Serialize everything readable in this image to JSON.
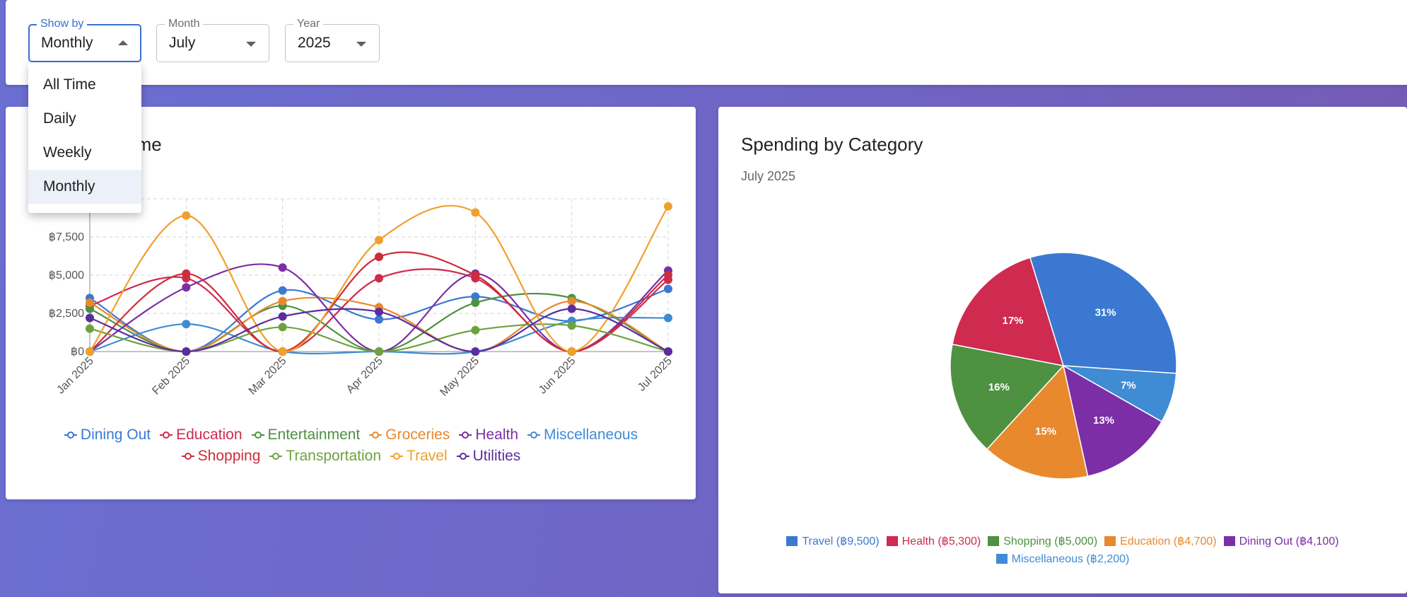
{
  "filters": {
    "show_by": {
      "label": "Show by",
      "value": "Monthly"
    },
    "month": {
      "label": "Month",
      "value": "July"
    },
    "year": {
      "label": "Year",
      "value": "2025"
    }
  },
  "dropdown": {
    "options": [
      "All Time",
      "Daily",
      "Weekly",
      "Monthly"
    ],
    "selected": "Monthly"
  },
  "line_card": {
    "title": "Spending Over Time",
    "visible_title_fragment": "er Time"
  },
  "pie_card": {
    "title": "Spending by Category",
    "subtitle": "July 2025"
  },
  "chart_data": [
    {
      "type": "line",
      "title": "Spending Over Time",
      "x": [
        "Jan 2025",
        "Feb 2025",
        "Mar 2025",
        "Apr 2025",
        "May 2025",
        "Jun 2025",
        "Jul 2025"
      ],
      "y_ticks": [
        "฿0",
        "฿2,500",
        "฿5,000",
        "฿7,500"
      ],
      "ylim": [
        0,
        10000
      ],
      "grid": true,
      "legend_position": "bottom",
      "series": [
        {
          "name": "Dining Out",
          "color": "#3a78d2",
          "values": [
            3500,
            0,
            4000,
            2100,
            3600,
            2000,
            4100
          ]
        },
        {
          "name": "Education",
          "color": "#cf2a4f",
          "values": [
            3000,
            4800,
            0,
            4800,
            4800,
            0,
            4700
          ]
        },
        {
          "name": "Entertainment",
          "color": "#4d9141",
          "values": [
            2800,
            0,
            3000,
            0,
            3200,
            3500,
            0
          ]
        },
        {
          "name": "Groceries",
          "color": "#e8892e",
          "values": [
            3200,
            0,
            3300,
            2900,
            0,
            3300,
            0
          ]
        },
        {
          "name": "Health",
          "color": "#7b2ea6",
          "values": [
            0,
            4200,
            5500,
            0,
            5100,
            0,
            5300
          ]
        },
        {
          "name": "Miscellaneous",
          "color": "#3f8bd4",
          "values": [
            0,
            1800,
            0,
            0,
            0,
            2000,
            2200
          ]
        },
        {
          "name": "Shopping",
          "color": "#cc2d3a",
          "values": [
            0,
            5100,
            0,
            6200,
            5000,
            0,
            5000
          ]
        },
        {
          "name": "Transportation",
          "color": "#6da23f",
          "values": [
            1500,
            0,
            1600,
            0,
            1400,
            1700,
            0
          ]
        },
        {
          "name": "Travel",
          "color": "#f0a02c",
          "values": [
            0,
            8900,
            0,
            7300,
            9100,
            0,
            9500
          ]
        },
        {
          "name": "Utilities",
          "color": "#5b2ca0",
          "values": [
            2200,
            0,
            2300,
            2600,
            0,
            2800,
            0
          ]
        }
      ]
    },
    {
      "type": "pie",
      "title": "Spending by Category",
      "subtitle": "July 2025",
      "legend_position": "bottom",
      "slices": [
        {
          "name": "Travel",
          "value": 9500,
          "label": "Travel (฿9,500)",
          "pct": "31%",
          "color": "#3a78d2"
        },
        {
          "name": "Health",
          "value": 5300,
          "label": "Health (฿5,300)",
          "pct": "17%",
          "color": "#cf2a4f"
        },
        {
          "name": "Shopping",
          "value": 5000,
          "label": "Shopping (฿5,000)",
          "pct": "16%",
          "color": "#4d9141"
        },
        {
          "name": "Education",
          "value": 4700,
          "label": "Education (฿4,700)",
          "pct": "15%",
          "color": "#e8892e"
        },
        {
          "name": "Dining Out",
          "value": 4100,
          "label": "Dining Out (฿4,100)",
          "pct": "13%",
          "color": "#7b2ea6"
        },
        {
          "name": "Miscellaneous",
          "value": 2200,
          "label": "Miscellaneous (฿2,200)",
          "pct": "7%",
          "color": "#3f8bd4"
        }
      ]
    }
  ]
}
